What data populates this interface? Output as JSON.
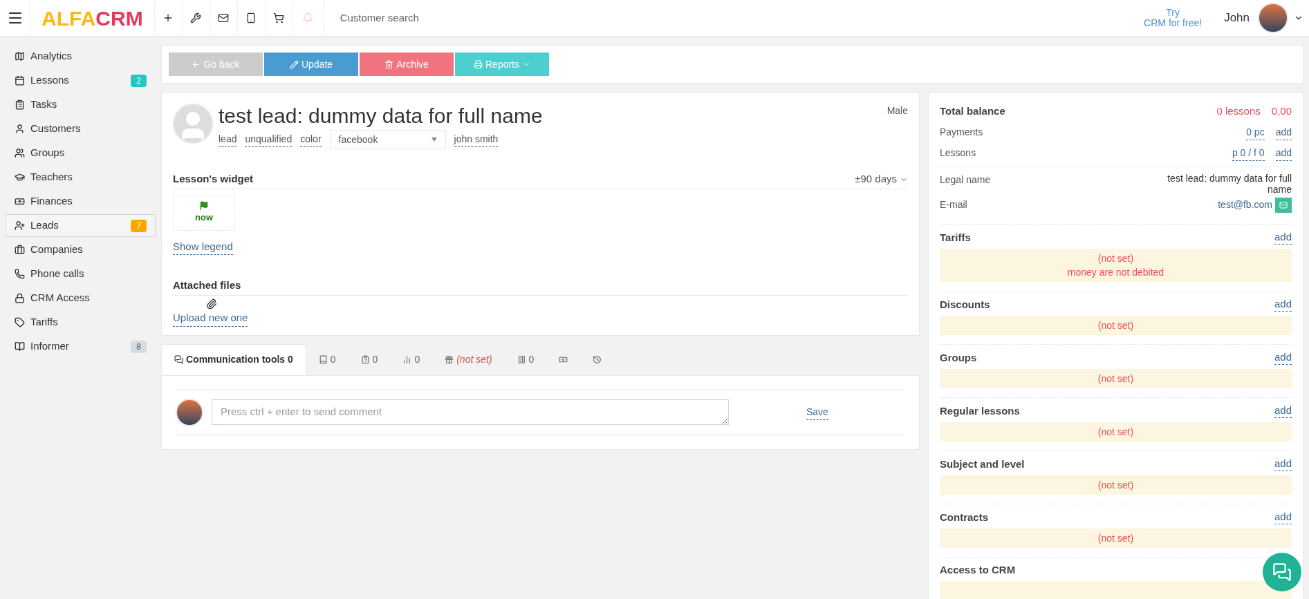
{
  "header": {
    "logo_left": "ALFA",
    "logo_right": "CRM",
    "search_placeholder": "Customer search",
    "promo_line1": "Try",
    "promo_line2": "CRM for free!",
    "user": "John"
  },
  "sidebar": {
    "items": [
      {
        "label": "Analytics",
        "selected": false
      },
      {
        "label": "Lessons",
        "badge": "2",
        "color": "#26c6c6",
        "selected": false
      },
      {
        "label": "Tasks",
        "selected": false
      },
      {
        "label": "Customers",
        "selected": false
      },
      {
        "label": "Groups",
        "selected": false
      },
      {
        "label": "Teachers",
        "selected": false
      },
      {
        "label": "Finances",
        "selected": false
      },
      {
        "label": "Leads",
        "badge": "7",
        "color": "#ffa500",
        "selected": true
      },
      {
        "label": "Companies",
        "selected": false
      },
      {
        "label": "Phone calls",
        "selected": false
      },
      {
        "label": "CRM Access",
        "selected": false
      },
      {
        "label": "Tariffs",
        "selected": false
      },
      {
        "label": "Informer",
        "badge": "8",
        "color": "#d5dde3",
        "selected": false
      }
    ]
  },
  "toolbar": [
    {
      "kind": "back",
      "label": "Go back"
    },
    {
      "kind": "update",
      "label": "Update"
    },
    {
      "kind": "archive",
      "label": "Archive"
    },
    {
      "kind": "reports",
      "label": "Reports"
    }
  ],
  "profile": {
    "name": "test lead: dummy data for full name",
    "gender": "Male",
    "tags": [
      "lead",
      "unqualified",
      "color"
    ],
    "source": "facebook",
    "owner": "john smith",
    "widget_title": "Lesson's widget",
    "range": "±90 days",
    "now": "now",
    "legend": "Show legend",
    "files_title": "Attached files",
    "upload": "Upload new one"
  },
  "tabs": [
    {
      "kind": "chat",
      "label": "Communication tools 0",
      "selected": true,
      "unset": false
    },
    {
      "kind": "book",
      "label": "0",
      "selected": false,
      "unset": false
    },
    {
      "kind": "clipboard",
      "label": "0",
      "selected": false,
      "unset": false
    },
    {
      "kind": "chart",
      "label": "0",
      "selected": false,
      "unset": false
    },
    {
      "kind": "gift",
      "label": "(not set)",
      "selected": false,
      "unset": true
    },
    {
      "kind": "pause",
      "label": "0",
      "selected": false,
      "unset": false
    },
    {
      "kind": "money",
      "selected": false
    },
    {
      "kind": "history",
      "selected": false
    }
  ],
  "comment": {
    "placeholder": "Press ctrl + enter to send comment",
    "save": "Save"
  },
  "balance": {
    "title": "Total balance",
    "lessons": "0 lessons",
    "amount": "0,00",
    "rows": [
      {
        "label": "Payments",
        "value": "0 pc",
        "action": "add"
      },
      {
        "label": "Lessons",
        "value": "p 0 / f 0",
        "action": "add"
      }
    ],
    "legal_label": "Legal name",
    "legal_value": "test lead: dummy data for full name",
    "email_label": "E-mail",
    "email": "test@fb.com"
  },
  "sections": [
    {
      "title": "Tariffs",
      "action": "add",
      "lines": [
        "(not set)",
        "money are not debited"
      ]
    },
    {
      "title": "Discounts",
      "action": "add",
      "lines": [
        "(not set)"
      ]
    },
    {
      "title": "Groups",
      "action": "add",
      "lines": [
        "(not set)"
      ]
    },
    {
      "title": "Regular lessons",
      "action": "add",
      "lines": [
        "(not set)"
      ]
    },
    {
      "title": "Subject and level",
      "action": "add",
      "lines": [
        "(not set)"
      ]
    },
    {
      "title": "Contracts",
      "action": "add",
      "lines": [
        "(not set)"
      ]
    },
    {
      "title": "Access to CRM"
    }
  ]
}
